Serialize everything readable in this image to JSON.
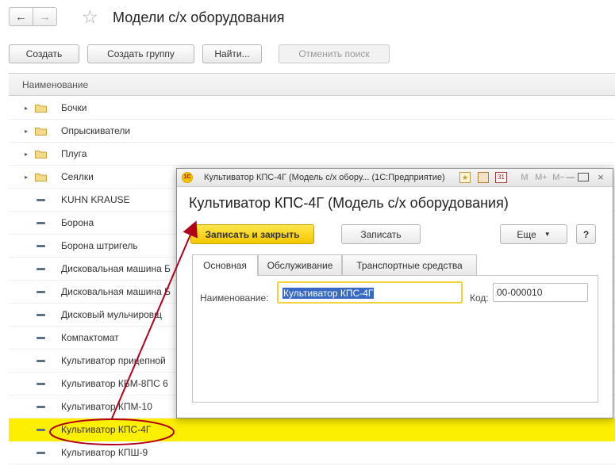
{
  "window": {
    "title": "Модели с/х оборудования",
    "nav_back": "←",
    "nav_forward": "→",
    "star": "☆"
  },
  "toolbar": {
    "create": "Создать",
    "create_group": "Создать группу",
    "find": "Найти...",
    "cancel_search": "Отменить поиск"
  },
  "list": {
    "column_header": "Наименование",
    "rows": [
      {
        "label": "Бочки",
        "kind": "folder"
      },
      {
        "label": "Опрыскиватели",
        "kind": "folder"
      },
      {
        "label": "Плуга",
        "kind": "folder"
      },
      {
        "label": "Сеялки",
        "kind": "folder"
      },
      {
        "label": "KUHN KRAUSE",
        "kind": "item"
      },
      {
        "label": "Борона",
        "kind": "item"
      },
      {
        "label": "Борона штригель",
        "kind": "item"
      },
      {
        "label": "Дисковальная машина Б",
        "kind": "item"
      },
      {
        "label": "Дисковальная машина Б",
        "kind": "item"
      },
      {
        "label": "Дисковый мульчировщ",
        "kind": "item"
      },
      {
        "label": "Компактомат",
        "kind": "item"
      },
      {
        "label": "Культиватор  прицепной",
        "kind": "item"
      },
      {
        "label": "Культиватор КБМ-8ПС 6",
        "kind": "item"
      },
      {
        "label": "Культиватор КПМ-10",
        "kind": "item"
      },
      {
        "label": "Культиватор КПС-4Г",
        "kind": "item",
        "selected": true
      },
      {
        "label": "Культиватор КПШ-9",
        "kind": "item"
      }
    ]
  },
  "dialog": {
    "caption": "Культиватор КПС-4Г (Модель с/х обору...  (1С:Предприятие)",
    "logo": "1С",
    "heading": "Культиватор КПС-4Г (Модель с/х оборудования)",
    "save_close": "Записать и закрыть",
    "save": "Записать",
    "more": "Еще",
    "help": "?",
    "titlebar_icons": {
      "fav": "★",
      "cal": "31",
      "m": "M",
      "m_plus": "M+",
      "m_minus": "M−",
      "min": "—",
      "close": "×"
    },
    "tabs": [
      "Основная",
      "Обслуживание",
      "Транспортные средства"
    ],
    "name_label": "Наименование:",
    "name_value": "Культиватор КПС-4Г",
    "code_label": "Код:",
    "code_value": "00-000010"
  },
  "colors": {
    "selection": "#fcef00",
    "primary_button": "#f3c700",
    "annotation": "#b0001a"
  }
}
